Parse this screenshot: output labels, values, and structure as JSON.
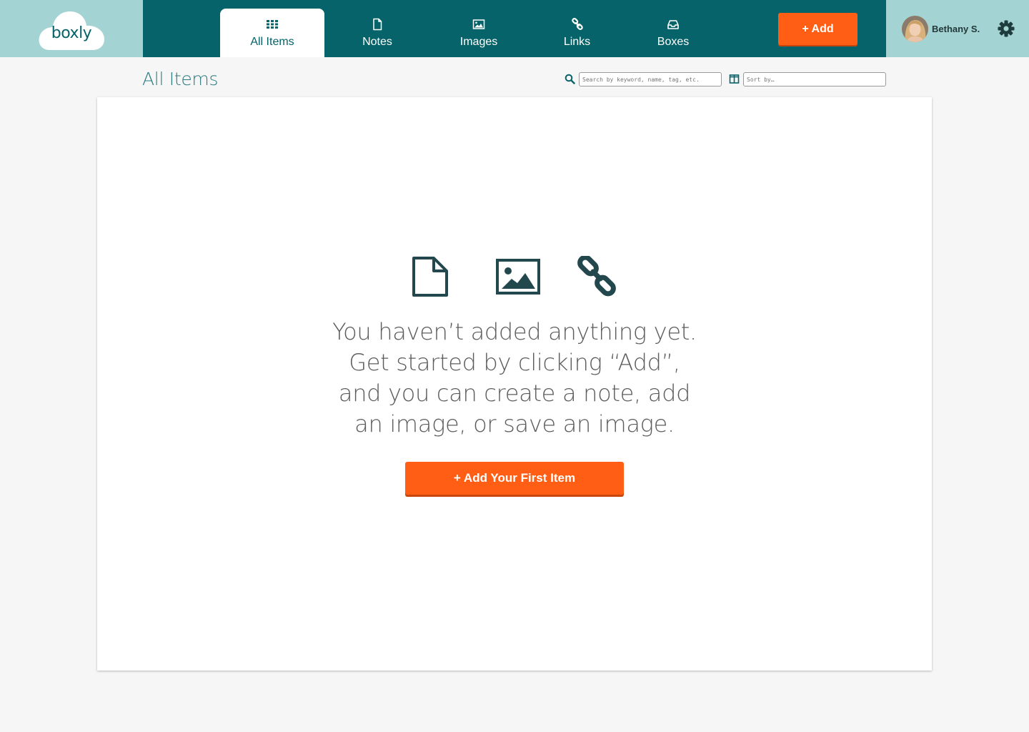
{
  "brand": {
    "logo_text": "boxly"
  },
  "nav": {
    "tabs": [
      {
        "label": "All Items",
        "icon": "grid-icon",
        "active": true
      },
      {
        "label": "Notes",
        "icon": "note-icon",
        "active": false
      },
      {
        "label": "Images",
        "icon": "image-icon",
        "active": false
      },
      {
        "label": "Links",
        "icon": "link-icon",
        "active": false
      },
      {
        "label": "Boxes",
        "icon": "inbox-icon",
        "active": false
      }
    ],
    "add_label": "+ Add"
  },
  "user": {
    "name": "Bethany S.",
    "avatar_icon": "user-avatar",
    "settings_icon": "gear-icon"
  },
  "page": {
    "title": "All Items",
    "search_placeholder": "Search by keyword, name, tag, etc.",
    "sort_placeholder": "Sort by…"
  },
  "empty_state": {
    "icons": [
      "note-icon",
      "image-icon",
      "link-icon"
    ],
    "message_lines": [
      "You haven’t added anything yet.",
      "Get started by clicking “Add”,",
      "and you can create a note, add",
      "an image, or save an image."
    ],
    "cta_label": "+ Add Your First Item"
  },
  "colors": {
    "brand_teal": "#066369",
    "light_teal": "#a3d3d3",
    "accent_orange": "#ff5e14",
    "icon_dark": "#22484d",
    "background": "#f6f6f6"
  }
}
